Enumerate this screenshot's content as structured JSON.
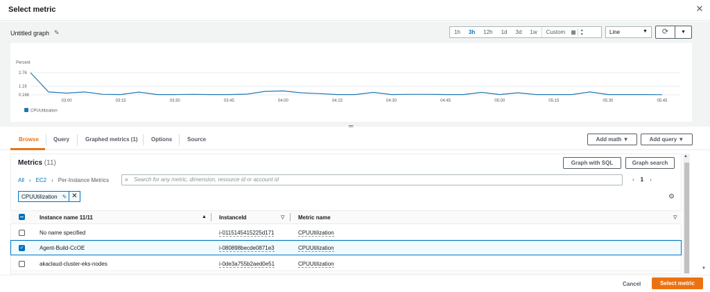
{
  "modal": {
    "title": "Select metric",
    "close_icon": "close-icon"
  },
  "graph": {
    "title": "Untitled graph",
    "time_ranges": [
      "1h",
      "3h",
      "12h",
      "1d",
      "3d",
      "1w"
    ],
    "selected_range": "3h",
    "custom_label": "Custom",
    "chart_type": "Line"
  },
  "chart_data": {
    "type": "line",
    "ylabel": "Percent",
    "y_ticks": [
      "2.76",
      "1.16",
      "0.166"
    ],
    "ylim": [
      0.166,
      2.76
    ],
    "x_ticks": [
      "03:00",
      "03:15",
      "03:30",
      "03:45",
      "04:00",
      "04:15",
      "04:30",
      "04:45",
      "05:00",
      "05:15",
      "05:30",
      "05:45"
    ],
    "series": [
      {
        "name": "CPUUtilization",
        "color": "#1f77b4",
        "x": [
          "02:50",
          "02:55",
          "03:00",
          "03:05",
          "03:10",
          "03:15",
          "03:20",
          "03:25",
          "03:30",
          "03:35",
          "03:40",
          "03:45",
          "03:50",
          "03:55",
          "04:00",
          "04:05",
          "04:10",
          "04:15",
          "04:20",
          "04:25",
          "04:30",
          "04:35",
          "04:40",
          "04:45",
          "04:50",
          "04:55",
          "05:00",
          "05:05",
          "05:10",
          "05:15",
          "05:20",
          "05:25",
          "05:30",
          "05:35",
          "05:40",
          "05:45"
        ],
        "values": [
          2.76,
          0.5,
          0.36,
          0.5,
          0.22,
          0.2,
          0.48,
          0.2,
          0.2,
          0.22,
          0.2,
          0.2,
          0.25,
          0.56,
          0.62,
          0.4,
          0.3,
          0.2,
          0.2,
          0.45,
          0.2,
          0.22,
          0.22,
          0.2,
          0.2,
          0.45,
          0.2,
          0.4,
          0.2,
          0.2,
          0.2,
          0.5,
          0.2,
          0.2,
          0.2,
          0.18
        ]
      }
    ]
  },
  "tabs": [
    {
      "label": "Browse"
    },
    {
      "label": "Query"
    },
    {
      "label": "Graphed metrics (1)"
    },
    {
      "label": "Options"
    },
    {
      "label": "Source"
    }
  ],
  "actions": {
    "add_math": "Add math",
    "add_query": "Add query"
  },
  "metrics": {
    "title": "Metrics",
    "count": "(11)",
    "graph_with_sql": "Graph with SQL",
    "graph_search": "Graph search",
    "breadcrumbs": [
      "All",
      "EC2",
      "Per-Instance Metrics"
    ],
    "search_placeholder": "Search for any metric, dimension, resource id or account id",
    "page": "1",
    "filter_token": "CPUUtilization",
    "columns": [
      "Instance name 11/11",
      "InstanceId",
      "Metric name"
    ],
    "rows": [
      {
        "name": "No name specified",
        "id": "i-0115145415225d171",
        "metric": "CPUUtilization",
        "checked": false
      },
      {
        "name": "Agent-Build-CcOE",
        "id": "i-080898becde0871e3",
        "metric": "CPUUtilization",
        "checked": true
      },
      {
        "name": "akaclaud-cluster-eks-nodes",
        "id": "i-0de3a755b2aed0e51",
        "metric": "CPUUtilization",
        "checked": false
      }
    ]
  },
  "footer": {
    "cancel": "Cancel",
    "select": "Select metric"
  }
}
